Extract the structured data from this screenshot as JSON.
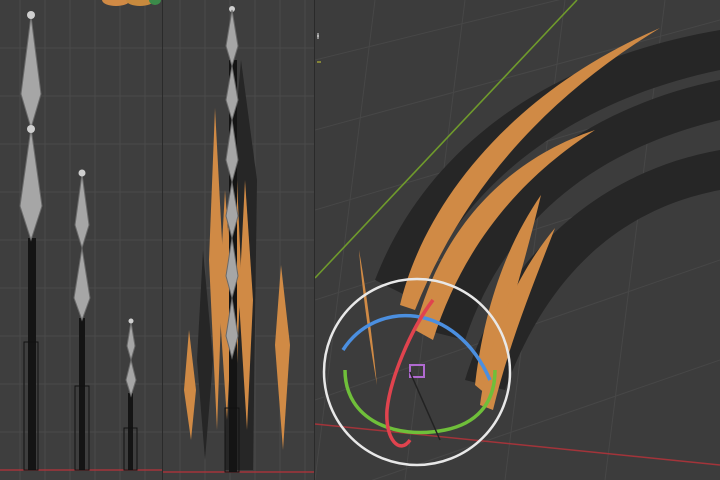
{
  "app": {
    "viewports": [
      {
        "id": "left",
        "view": "rig-bones-front"
      },
      {
        "id": "mid",
        "view": "rig-with-hair-side"
      },
      {
        "id": "right",
        "view": "perspective-hair-with-rotate-gizmo"
      }
    ]
  },
  "colors": {
    "background": "#3d3d3d",
    "grid_line": "#4a4a4a",
    "bone": "#a6a6a6",
    "bone_shaft": "#141414",
    "hair_strand": "#d08a45",
    "hair_shadow": "#262626",
    "x_axis": "#a3343a",
    "y_axis": "#6f9a2c",
    "gizmo_outer": "#e8e8e8",
    "gizmo_x": "#e0434e",
    "gizmo_y": "#6fbf3a",
    "gizmo_z": "#4b8fe0",
    "gizmo_pivot": "#b06ad0"
  },
  "icons": {
    "cursor": "crosshair-cursor-icon",
    "thumbnail": "object-thumbnail-icon",
    "gizmo": "rotate-gizmo-icon"
  }
}
